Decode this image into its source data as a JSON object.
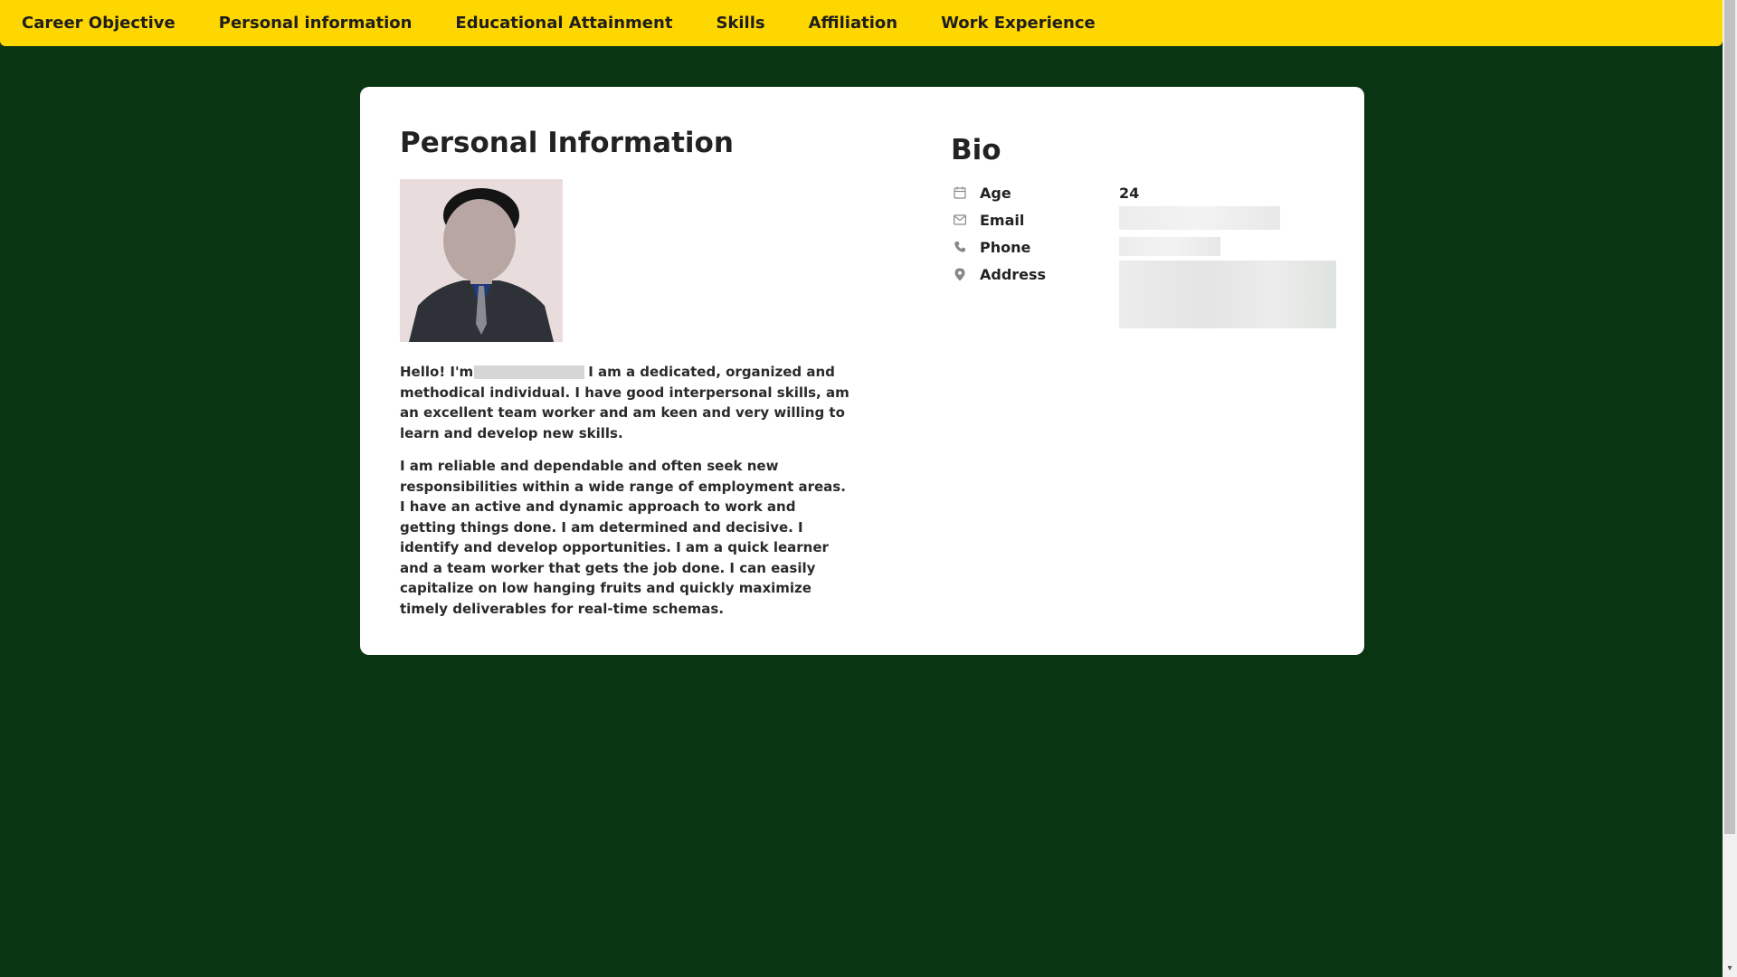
{
  "nav": {
    "items": [
      {
        "label": "Career Objective"
      },
      {
        "label": "Personal information"
      },
      {
        "label": "Educational Attainment"
      },
      {
        "label": "Skills"
      },
      {
        "label": "Affiliation"
      },
      {
        "label": "Work Experience"
      }
    ]
  },
  "personal": {
    "title": "Personal Information",
    "intro_prefix": "Hello! I'm",
    "intro_suffix": "I am a dedicated, organized and methodical individual. I have good interpersonal skills, am an excellent team worker and am keen and very willing to learn and develop new skills.",
    "paragraph2": "I am reliable and dependable and often seek new responsibilities within a wide range of employment areas. I have an active and dynamic approach to work and getting things done. I am determined and decisive. I identify and develop opportunities. I am a quick learner and a team worker that gets the job done. I can easily capitalize on low hanging fruits and quickly maximize timely deliverables for real-time schemas."
  },
  "bio": {
    "title": "Bio",
    "age_label": "Age",
    "age_value": "24",
    "email_label": "Email",
    "phone_label": "Phone",
    "address_label": "Address"
  },
  "colors": {
    "background": "#0a3512",
    "navbar": "#ffd700",
    "card": "#ffffff"
  }
}
